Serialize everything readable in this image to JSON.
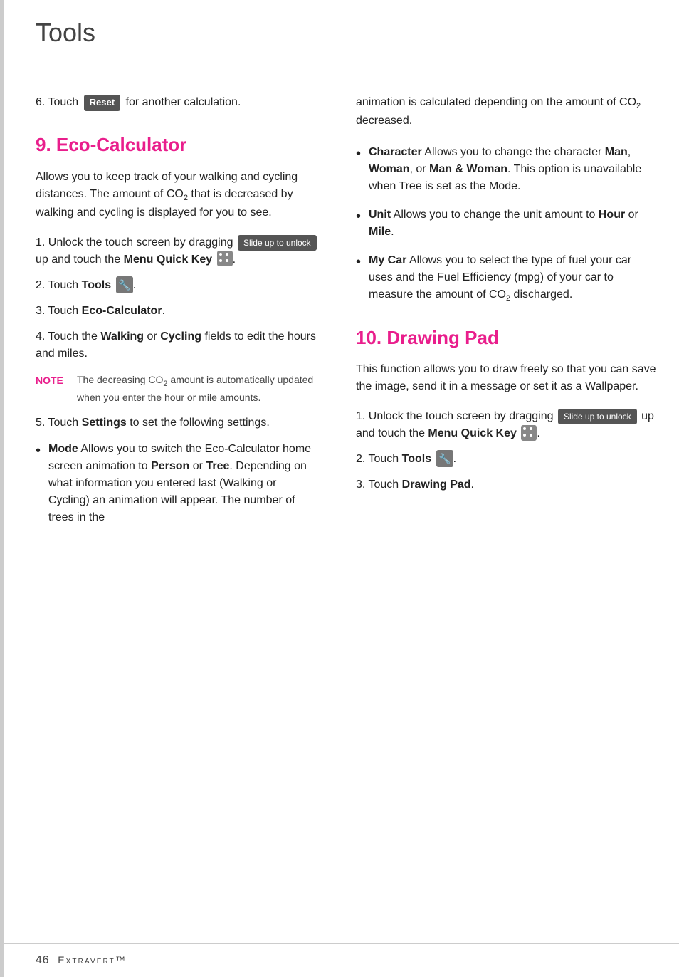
{
  "page": {
    "title": "Tools",
    "left_bar_color": "#bbbbbb",
    "footer": {
      "page_number": "46",
      "brand": "Extravert™"
    }
  },
  "step6": {
    "text_before": "6. Touch ",
    "reset_btn": "Reset",
    "text_after": " for another calculation."
  },
  "section9": {
    "heading": "9. Eco-Calculator",
    "intro": "Allows you to keep track of your walking and cycling distances. The amount of CO₂ that is decreased by walking and cycling is displayed for you to see.",
    "steps": [
      {
        "num": "1.",
        "text_before": "Unlock the touch screen by dragging ",
        "slide_btn": "Slide up to unlock",
        "text_after": " up and touch the ",
        "bold": "Menu Quick Key",
        "has_menu_icon": true,
        "text_end": "."
      },
      {
        "num": "2.",
        "text_before": "Touch ",
        "bold": "Tools",
        "has_tools_icon": true,
        "text_end": "."
      },
      {
        "num": "3.",
        "text_before": "Touch ",
        "bold": "Eco-Calculator",
        "text_end": "."
      },
      {
        "num": "4.",
        "text_before": "Touch the ",
        "bold1": "Walking",
        "text_middle": " or ",
        "bold2": "Cycling",
        "text_end": " fields to edit the hours and miles."
      }
    ],
    "note": {
      "label": "NOTE",
      "text": "The decreasing CO₂ amount is automatically updated when you enter the hour or mile amounts."
    },
    "step5": {
      "text": "5. Touch ",
      "bold": "Settings",
      "text_end": " to set the following settings."
    },
    "bullets": [
      {
        "bold": "Mode",
        "text": " Allows you to switch the Eco-Calculator home screen animation to ",
        "bold2": "Person",
        "text2": " or ",
        "bold3": "Tree",
        "text3": ". Depending on what information you entered last (Walking or Cycling) an animation will appear. The number of trees in the"
      }
    ]
  },
  "section9_right": {
    "continued_text": "animation is calculated depending on the amount of CO₂ decreased.",
    "bullets": [
      {
        "bold": "Character",
        "text": " Allows you to change the character ",
        "bold2": "Man",
        "text2": ", ",
        "bold3": "Woman",
        "text3": ", or ",
        "bold4": "Man & Woman",
        "text4": ". This option is unavailable when Tree is set as the Mode."
      },
      {
        "bold": "Unit",
        "text": " Allows you to change the unit amount to ",
        "bold2": "Hour",
        "text2": " or ",
        "bold3": "Mile",
        "text3": "."
      },
      {
        "bold": "My Car",
        "text": " Allows you to select the type of fuel your car uses and the Fuel Efficiency (mpg) of your car to measure the amount of CO₂ discharged."
      }
    ]
  },
  "section10": {
    "heading": "10. Drawing Pad",
    "intro": "This function allows you to draw freely so that you can save the image, send it in a message or set it as a Wallpaper.",
    "steps": [
      {
        "num": "1.",
        "text_before": "Unlock the touch screen by dragging ",
        "slide_btn": "Slide up to unlock",
        "text_after": " up and touch the ",
        "bold": "Menu Quick Key",
        "has_menu_icon": true,
        "text_end": "."
      },
      {
        "num": "2.",
        "text_before": "Touch ",
        "bold": "Tools",
        "has_tools_icon": true,
        "text_end": "."
      },
      {
        "num": "3.",
        "text_before": "Touch ",
        "bold": "Drawing Pad",
        "text_end": "."
      }
    ]
  },
  "touch_tools": {
    "label": "Touch Tools"
  }
}
